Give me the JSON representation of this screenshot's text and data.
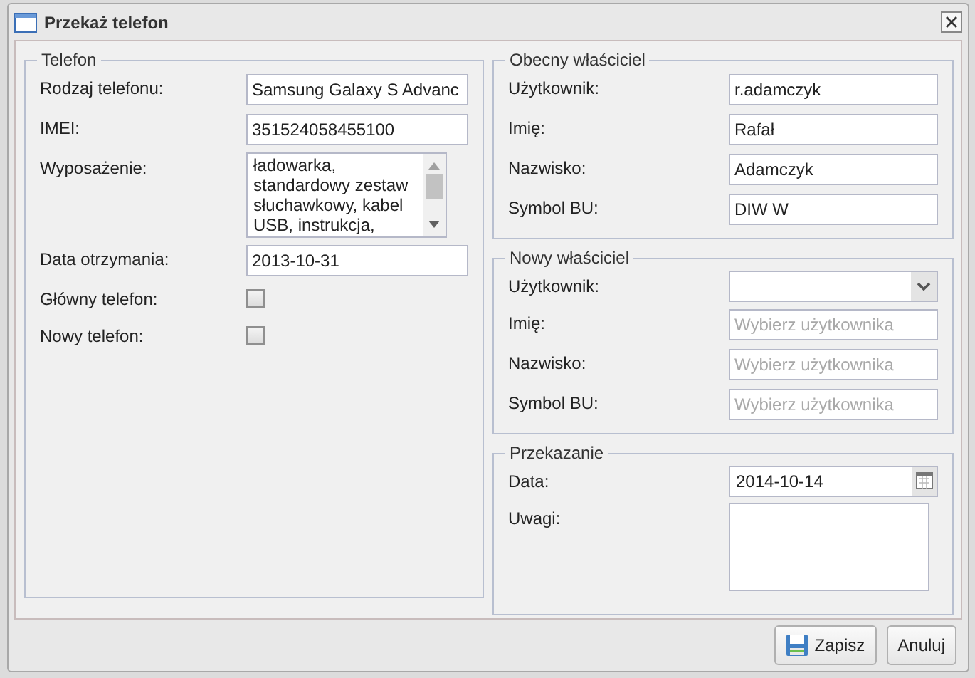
{
  "window": {
    "title": "Przekaż telefon"
  },
  "left_groups": [
    {
      "title": "Telefon",
      "fields": [
        {
          "label": "Rodzaj telefonu:",
          "kind": "text",
          "value": "Samsung Galaxy S Advanc"
        },
        {
          "label": "IMEI:",
          "kind": "text",
          "value": "351524058455100"
        },
        {
          "label": "Wyposażenie:",
          "kind": "textarea",
          "value": "ładowarka, standardowy zestaw słuchawkowy, kabel USB, instrukcja,"
        },
        {
          "label": "Data otrzymania:",
          "kind": "text",
          "value": "2013-10-31"
        },
        {
          "label": "Główny telefon:",
          "kind": "checkbox",
          "checked": false
        },
        {
          "label": "Nowy telefon:",
          "kind": "checkbox",
          "checked": false
        }
      ]
    }
  ],
  "right_groups": [
    {
      "title": "Obecny właściciel",
      "fields": [
        {
          "label": "Użytkownik:",
          "kind": "text",
          "value": "r.adamczyk"
        },
        {
          "label": "Imię:",
          "kind": "text",
          "value": "Rafał"
        },
        {
          "label": "Nazwisko:",
          "kind": "text",
          "value": "Adamczyk"
        },
        {
          "label": "Symbol BU:",
          "kind": "text",
          "value": "DIW W"
        }
      ]
    },
    {
      "title": "Nowy właściciel",
      "fields": [
        {
          "label": "Użytkownik:",
          "kind": "select"
        },
        {
          "label": "Imię:",
          "kind": "text",
          "placeholder": "Wybierz użytkownika"
        },
        {
          "label": "Nazwisko:",
          "kind": "text",
          "placeholder": "Wybierz użytkownika"
        },
        {
          "label": "Symbol BU:",
          "kind": "text",
          "placeholder": "Wybierz użytkownika"
        }
      ]
    },
    {
      "title": "Przekazanie",
      "fields": [
        {
          "label": "Data:",
          "kind": "date",
          "value": "2014-10-14"
        },
        {
          "label": "Uwagi:",
          "kind": "notes"
        }
      ]
    }
  ],
  "buttons": [
    {
      "label": "Zapisz",
      "kind": "save"
    },
    {
      "label": "Anuluj",
      "kind": "cancel"
    }
  ]
}
